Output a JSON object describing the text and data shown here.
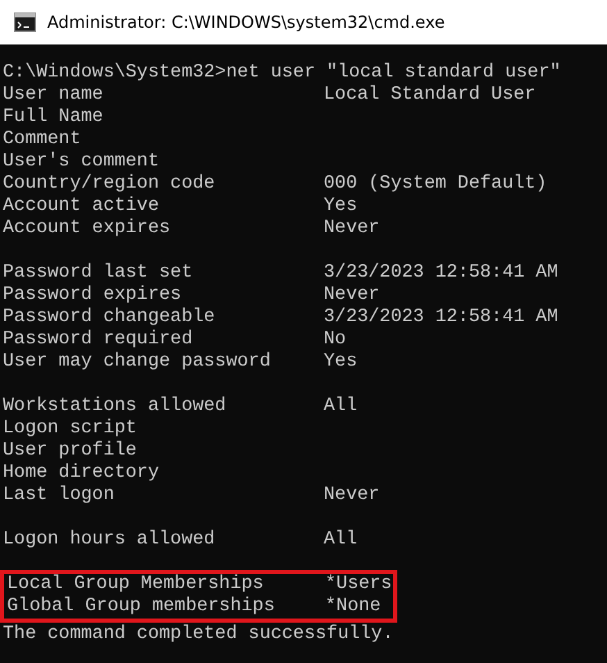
{
  "window": {
    "title": "Administrator: C:\\WINDOWS\\system32\\cmd.exe"
  },
  "console": {
    "lines": [
      {
        "kind": "prompt",
        "text": "C:\\Windows\\System32>net user \"local standard user\""
      },
      {
        "kind": "field",
        "label": "User name",
        "value": "Local Standard User",
        "highlighted": false
      },
      {
        "kind": "field",
        "label": "Full Name",
        "highlighted": false
      },
      {
        "kind": "field",
        "label": "Comment",
        "highlighted": false
      },
      {
        "kind": "field",
        "label": "User's comment",
        "highlighted": false
      },
      {
        "kind": "field",
        "label": "Country/region code",
        "value": "000 (System Default)",
        "highlighted": false
      },
      {
        "kind": "field",
        "label": "Account active",
        "value": "Yes",
        "highlighted": false
      },
      {
        "kind": "field",
        "label": "Account expires",
        "value": "Never",
        "highlighted": false
      },
      {
        "kind": "blank"
      },
      {
        "kind": "field",
        "label": "Password last set",
        "value": "3/23/2023 12:58:41 AM",
        "highlighted": false
      },
      {
        "kind": "field",
        "label": "Password expires",
        "value": "Never",
        "highlighted": false
      },
      {
        "kind": "field",
        "label": "Password changeable",
        "value": "3/23/2023 12:58:41 AM",
        "highlighted": false
      },
      {
        "kind": "field",
        "label": "Password required",
        "value": "No",
        "highlighted": false
      },
      {
        "kind": "field",
        "label": "User may change password",
        "value": "Yes",
        "highlighted": false
      },
      {
        "kind": "blank"
      },
      {
        "kind": "field",
        "label": "Workstations allowed",
        "value": "All",
        "highlighted": false
      },
      {
        "kind": "field",
        "label": "Logon script",
        "highlighted": false
      },
      {
        "kind": "field",
        "label": "User profile",
        "highlighted": false
      },
      {
        "kind": "field",
        "label": "Home directory",
        "highlighted": false
      },
      {
        "kind": "field",
        "label": "Last logon",
        "value": "Never",
        "highlighted": false
      },
      {
        "kind": "blank"
      },
      {
        "kind": "field",
        "label": "Logon hours allowed",
        "value": "All",
        "highlighted": false
      },
      {
        "kind": "blank"
      },
      {
        "kind": "field",
        "label": "Local Group Memberships",
        "value": "*Users",
        "highlighted": true
      },
      {
        "kind": "field",
        "label": "Global Group memberships",
        "value": "*None",
        "highlighted": true
      },
      {
        "kind": "message",
        "text": "The command completed successfully."
      }
    ]
  }
}
